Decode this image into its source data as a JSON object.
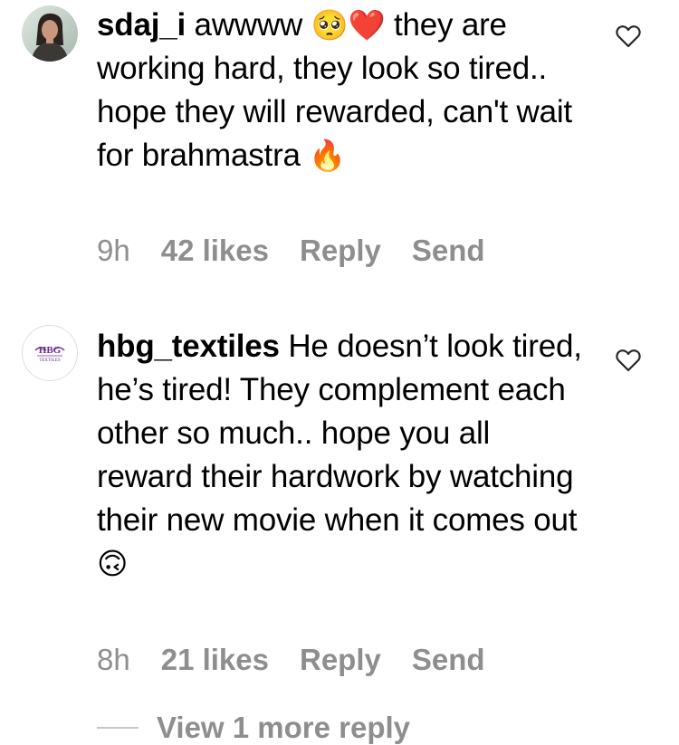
{
  "comments": [
    {
      "username": "sdaj_i",
      "text_before_emoji": " awwww ",
      "emojis_1": "🥺❤️",
      "text_after_emoji": " they are working hard, they look so tired.. hope they will rewarded, can't wait for brahmastra ",
      "trailing_emoji": "🔥",
      "time": "9h",
      "likes": "42 likes",
      "reply_label": "Reply",
      "send_label": "Send",
      "avatar_icon": "user-photo-avatar",
      "like_icon": "heart-outline-icon"
    },
    {
      "username": "hbg_textiles",
      "text": " He doesn’t look tired, he’s tired! They complement each other so much.. hope you all reward their hardwork by watching their new movie when it comes out ",
      "trailing_emoji": "🙃",
      "time": "8h",
      "likes": "21 likes",
      "reply_label": "Reply",
      "send_label": "Send",
      "avatar_logo_top": "HBG",
      "avatar_logo_bottom": "TEXTILES",
      "like_icon": "heart-outline-icon"
    }
  ],
  "view_more": {
    "label": "View 1 more reply"
  },
  "colors": {
    "secondary_text": "#8e8e8e",
    "brand_purple": "#6b2c91"
  }
}
